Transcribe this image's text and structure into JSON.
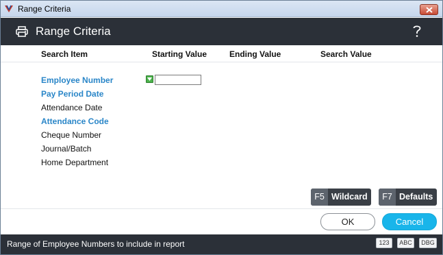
{
  "window": {
    "title": "Range Criteria"
  },
  "header": {
    "title": "Range Criteria",
    "help_glyph": "?"
  },
  "columns": {
    "search_item": "Search Item",
    "starting_value": "Starting Value",
    "ending_value": "Ending Value",
    "search_value": "Search Value"
  },
  "items": [
    {
      "label": "Employee Number",
      "active": true
    },
    {
      "label": "Pay Period Date",
      "active": true
    },
    {
      "label": "Attendance Date",
      "active": false
    },
    {
      "label": "Attendance Code",
      "active": true
    },
    {
      "label": "Cheque Number",
      "active": false
    },
    {
      "label": "Journal/Batch",
      "active": false
    },
    {
      "label": "Home Department",
      "active": false
    }
  ],
  "fields": {
    "starting_value": ""
  },
  "function_buttons": {
    "wildcard": {
      "key": "F5",
      "label": "Wildcard"
    },
    "defaults": {
      "key": "F7",
      "label": "Defaults"
    }
  },
  "dialog_buttons": {
    "ok": "OK",
    "cancel": "Cancel"
  },
  "status": {
    "text": "Range of Employee Numbers to include in report",
    "badges": [
      "123",
      "ABC",
      "DBG"
    ]
  },
  "colors": {
    "header_bg": "#2b3038",
    "active_item": "#2a86c8",
    "cancel_button": "#19b5ea",
    "green_chip": "#4bb24b"
  },
  "icons": [
    "app-logo-icon",
    "close-icon",
    "printer-icon",
    "help-icon",
    "dropdown-chip-icon"
  ]
}
